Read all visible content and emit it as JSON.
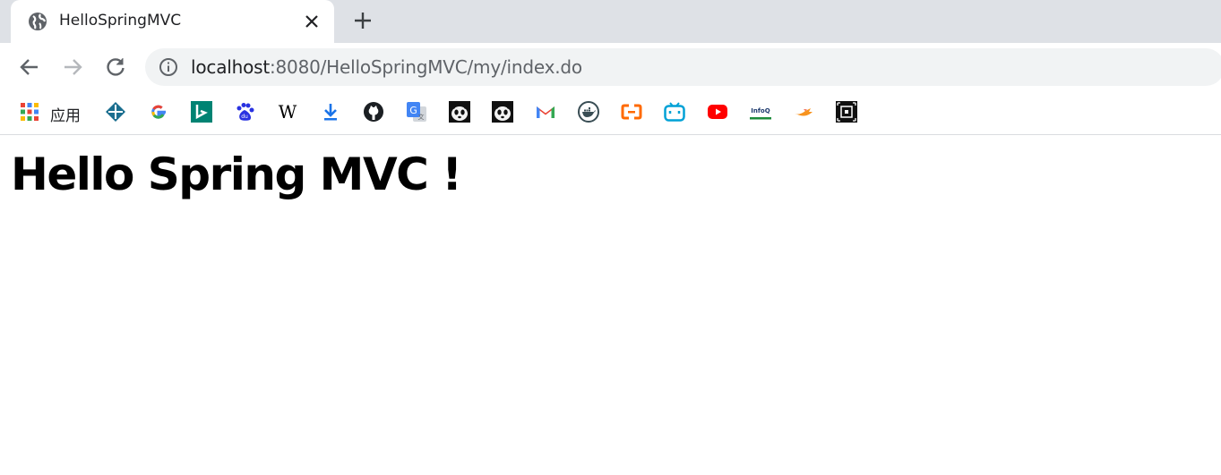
{
  "tab": {
    "title": "HelloSpringMVC"
  },
  "omnibox": {
    "host": "localhost",
    "rest": ":8080/HelloSpringMVC/my/index.do"
  },
  "bookmarks": {
    "apps_label": "应用",
    "items": [
      {
        "icon": "apps-grid-icon"
      },
      {
        "icon": "compass-diamond-icon"
      },
      {
        "icon": "google-icon"
      },
      {
        "icon": "bing-icon"
      },
      {
        "icon": "baidu-icon"
      },
      {
        "icon": "wikipedia-icon"
      },
      {
        "icon": "download-icon"
      },
      {
        "icon": "github-icon"
      },
      {
        "icon": "google-translate-icon"
      },
      {
        "icon": "panda-icon"
      },
      {
        "icon": "panda-icon"
      },
      {
        "icon": "gmail-icon"
      },
      {
        "icon": "docker-icon"
      },
      {
        "icon": "aliyun-icon"
      },
      {
        "icon": "bilibili-icon"
      },
      {
        "icon": "youtube-icon"
      },
      {
        "icon": "infoq-icon"
      },
      {
        "icon": "swift-like-icon"
      },
      {
        "icon": "dark-square-icon"
      }
    ],
    "wikipedia_glyph": "W",
    "infoq_text": "InfoQ"
  },
  "page": {
    "heading": "Hello Spring MVC !"
  },
  "colors": {
    "tabstrip": "#dee1e6",
    "omnibox": "#f1f3f4",
    "text": "#202124",
    "muted": "#5f6368"
  }
}
